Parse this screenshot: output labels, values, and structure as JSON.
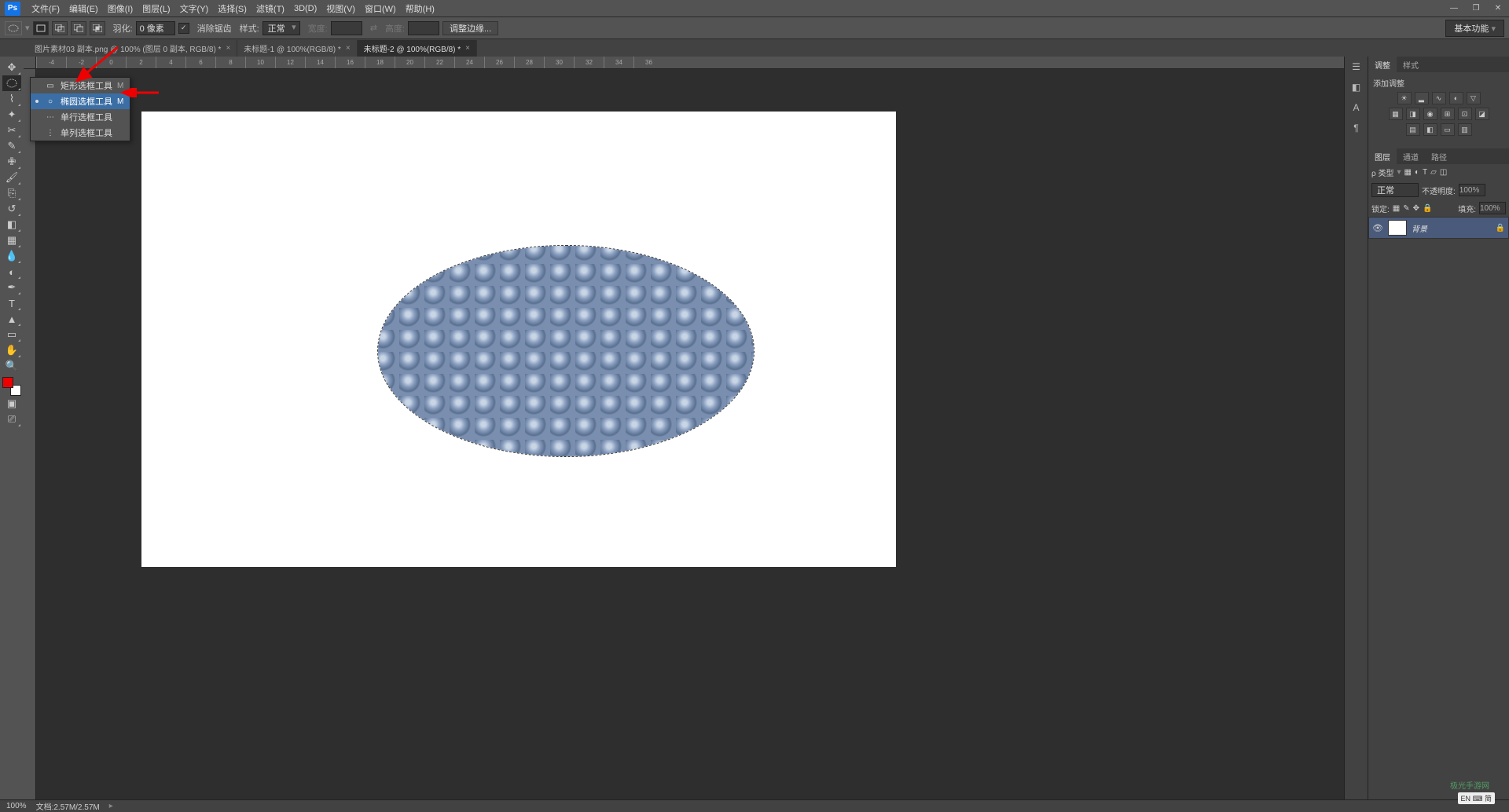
{
  "app": {
    "logo": "Ps"
  },
  "menu": {
    "items": [
      "文件(F)",
      "编辑(E)",
      "图像(I)",
      "图层(L)",
      "文字(Y)",
      "选择(S)",
      "滤镜(T)",
      "3D(D)",
      "视图(V)",
      "窗口(W)",
      "帮助(H)"
    ]
  },
  "win_controls": {
    "min": "—",
    "max": "❐",
    "close": "✕"
  },
  "options": {
    "feather_label": "羽化:",
    "feather_value": "0 像素",
    "antialias_label": "消除锯齿",
    "style_label": "样式:",
    "style_value": "正常",
    "width_label": "宽度:",
    "swap": "⇄",
    "height_label": "高度:",
    "refine_label": "调整边缘...",
    "workspace": "基本功能"
  },
  "tabs": [
    {
      "label": "图片素材03 副本.png @ 100% (图层 0 副本, RGB/8) *",
      "active": false
    },
    {
      "label": "未标题-1 @ 100%(RGB/8) *",
      "active": false
    },
    {
      "label": "未标题-2 @ 100%(RGB/8) *",
      "active": true
    }
  ],
  "flyout": {
    "items": [
      {
        "icon": "▭",
        "label": "矩形选框工具",
        "shortcut": "M",
        "selected": false
      },
      {
        "icon": "○",
        "label": "椭圆选框工具",
        "shortcut": "M",
        "selected": true
      },
      {
        "icon": "⋯",
        "label": "单行选框工具",
        "shortcut": "",
        "selected": false
      },
      {
        "icon": "⋮",
        "label": "单列选框工具",
        "shortcut": "",
        "selected": false
      }
    ]
  },
  "ruler_ticks": [
    -4,
    -2,
    0,
    2,
    4,
    6,
    8,
    10,
    12,
    14,
    16,
    18,
    20,
    22,
    24,
    26,
    28,
    30,
    32,
    34,
    36
  ],
  "right_panels": {
    "adjust_tabs": [
      "调整",
      "样式"
    ],
    "adjust_title": "添加调整",
    "layer_tabs": [
      "图层",
      "通道",
      "路径"
    ],
    "layer_kind_label": "ρ 类型",
    "blend_mode": "正常",
    "opacity_label": "不透明度:",
    "opacity_value": "100%",
    "lock_label": "锁定:",
    "fill_label": "填充:",
    "fill_value": "100%",
    "bg_layer": "背景"
  },
  "status": {
    "zoom": "100%",
    "doc": "文档:2.57M/2.57M"
  },
  "ime": "EN ⌨ 简",
  "watermark": "极光手游网"
}
